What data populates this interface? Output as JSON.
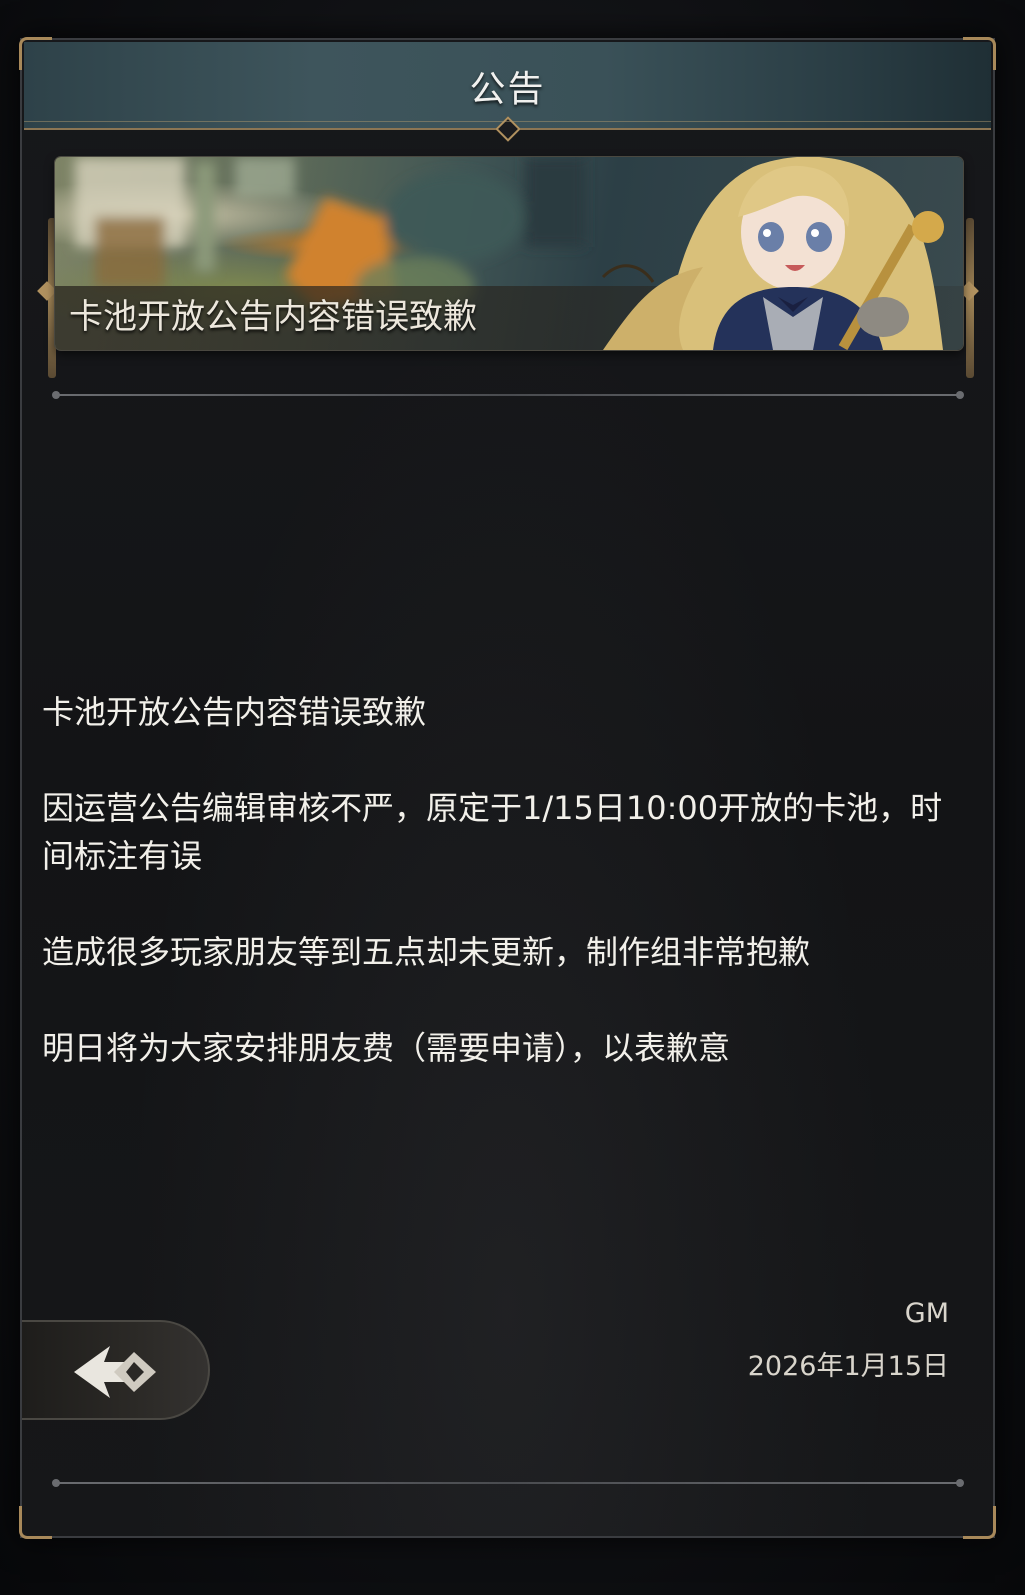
{
  "window": {
    "title": "公告"
  },
  "banner": {
    "title": "卡池开放公告内容错误致歉"
  },
  "article": {
    "paragraphs": [
      "卡池开放公告内容错误致歉",
      "因运营公告编辑审核不严，原定于1/15日10:00开放的卡池，时间标注有误",
      "造成很多玩家朋友等到五点却未更新，制作组非常抱歉",
      "明日将为大家安排朋友费（需要申请），以表歉意"
    ],
    "author": "GM",
    "date": "2026年1月15日"
  },
  "icons": {
    "back": "back-arrow-icon"
  },
  "colors": {
    "title_bar": "#3e555c",
    "gold_trim": "#a8895a",
    "panel_bg": "#151619",
    "text": "#f2f0ea"
  }
}
